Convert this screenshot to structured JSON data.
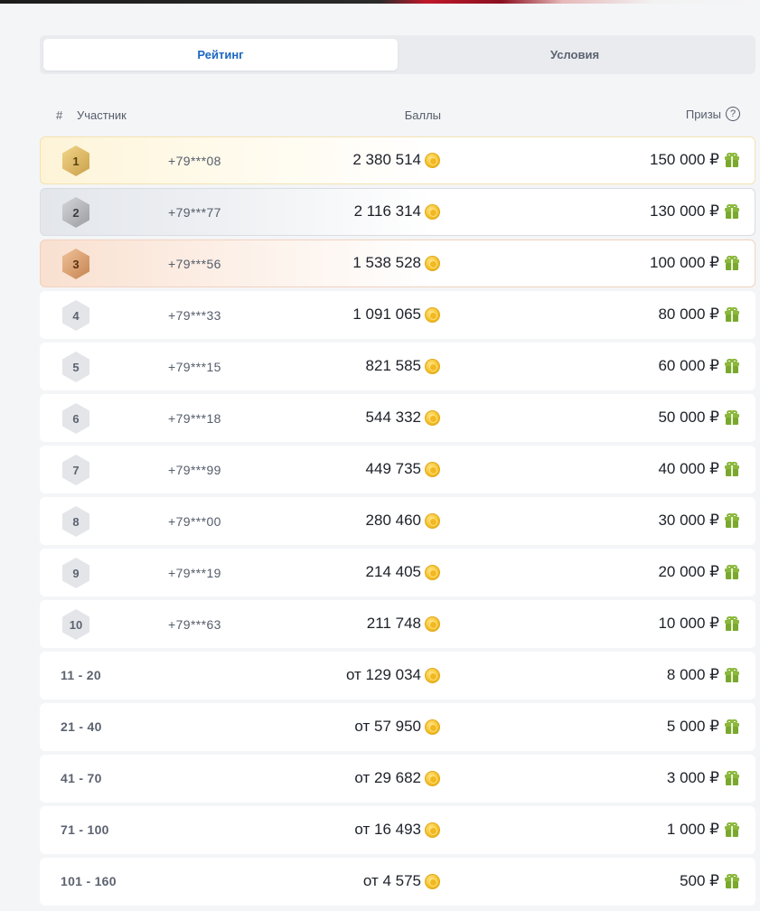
{
  "tabs": [
    {
      "label": "Рейтинг",
      "active": true
    },
    {
      "label": "Условия",
      "active": false
    }
  ],
  "table": {
    "columns": {
      "num": "#",
      "participant": "Участник",
      "points": "Баллы",
      "prizes": "Призы"
    }
  },
  "rows": [
    {
      "rank": "1",
      "user": "+79***08",
      "points": "2 380 514",
      "prize": "150 000 ₽",
      "tier": "gold"
    },
    {
      "rank": "2",
      "user": "+79***77",
      "points": "2 116 314",
      "prize": "130 000 ₽",
      "tier": "silver"
    },
    {
      "rank": "3",
      "user": "+79***56",
      "points": "1 538 528",
      "prize": "100 000 ₽",
      "tier": "bronze"
    },
    {
      "rank": "4",
      "user": "+79***33",
      "points": "1 091 065",
      "prize": "80 000 ₽"
    },
    {
      "rank": "5",
      "user": "+79***15",
      "points": "821 585",
      "prize": "60 000 ₽"
    },
    {
      "rank": "6",
      "user": "+79***18",
      "points": "544 332",
      "prize": "50 000 ₽"
    },
    {
      "rank": "7",
      "user": "+79***99",
      "points": "449 735",
      "prize": "40 000 ₽"
    },
    {
      "rank": "8",
      "user": "+79***00",
      "points": "280 460",
      "prize": "30 000 ₽"
    },
    {
      "rank": "9",
      "user": "+79***19",
      "points": "214 405",
      "prize": "20 000 ₽"
    },
    {
      "rank": "10",
      "user": "+79***63",
      "points": "211 748",
      "prize": "10 000 ₽"
    }
  ],
  "ranges": [
    {
      "range": "11 - 20",
      "points": "от 129 034",
      "prize": "8 000 ₽"
    },
    {
      "range": "21 - 40",
      "points": "от 57 950",
      "prize": "5 000 ₽"
    },
    {
      "range": "41 - 70",
      "points": "от 29 682",
      "prize": "3 000 ₽"
    },
    {
      "range": "71 - 100",
      "points": "от 16 493",
      "prize": "1 000 ₽"
    },
    {
      "range": "101 - 160",
      "points": "от 4 575",
      "prize": "500 ₽"
    }
  ],
  "icons": {
    "coin": "coin-icon",
    "gift": "gift-icon",
    "help": "question-circle-icon"
  },
  "colors": {
    "accent": "#1a66c2",
    "gift": "#7aa82e",
    "coin": "#f5c22b"
  }
}
